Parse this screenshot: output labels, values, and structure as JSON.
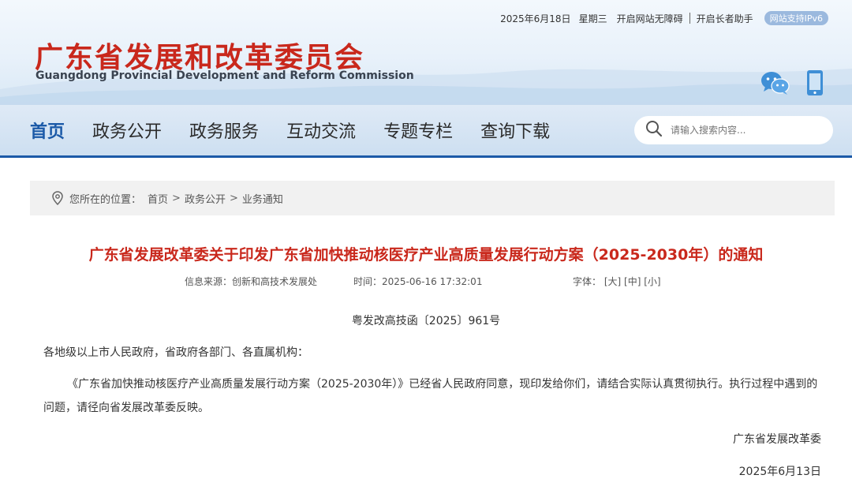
{
  "topbar": {
    "date": "2025年6月18日",
    "weekday": "星期三",
    "accessibility": "开启网站无障碍",
    "elder": "开启长者助手",
    "ipv6": "网站支持IPv6"
  },
  "logo": {
    "cn": "广东省发展和改革委员会",
    "en": "Guangdong Provincial Development and Reform Commission"
  },
  "nav": {
    "items": [
      "首页",
      "政务公开",
      "政务服务",
      "互动交流",
      "专题专栏",
      "查询下载"
    ],
    "search_placeholder": "请输入搜索内容..."
  },
  "breadcrumb": {
    "label": "您所在的位置：",
    "items": [
      "首页",
      "政务公开",
      "业务通知"
    ],
    "separator": ">"
  },
  "article": {
    "title": "广东省发展改革委关于印发广东省加快推动核医疗产业高质量发展行动方案（2025-2030年）的通知",
    "source": "信息来源：创新和高技术发展处",
    "time": "时间：2025-06-16 17:32:01",
    "font_label": "字体：",
    "font_large": "[大]",
    "font_medium": "[中]",
    "font_small": "[小]",
    "doc_number": "粤发改高技函〔2025〕961号",
    "salutation": "各地级以上市人民政府，省政府各部门、各直属机构：",
    "body": "《广东省加快推动核医疗产业高质量发展行动方案（2025-2030年）》已经省人民政府同意，现印发给你们，请结合实际认真贯彻执行。执行过程中遇到的问题，请径向省发展改革委反映。",
    "signature": "广东省发展改革委",
    "date": "2025年6月13日"
  },
  "colors": {
    "brand_red": "#c9281c",
    "nav_blue": "#1c5aa8"
  }
}
